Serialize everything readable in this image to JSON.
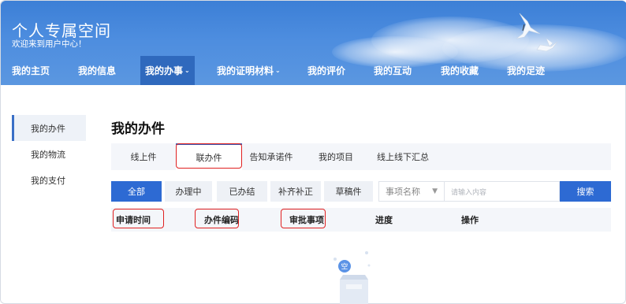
{
  "header": {
    "title": "个人专属空间",
    "subtitle": "欢迎来到用户中心！"
  },
  "nav": {
    "items": [
      {
        "label": "我的主页"
      },
      {
        "label": "我的信息"
      },
      {
        "label": "我的办事",
        "caret": "⌄"
      },
      {
        "label": "我的证明材料",
        "caret": "⌄"
      },
      {
        "label": "我的评价"
      },
      {
        "label": "我的互动"
      },
      {
        "label": "我的收藏"
      },
      {
        "label": "我的足迹"
      }
    ]
  },
  "sidebar": {
    "items": [
      {
        "label": "我的办件"
      },
      {
        "label": "我的物流"
      },
      {
        "label": "我的支付"
      }
    ]
  },
  "main": {
    "title": "我的办件",
    "tabs": [
      {
        "label": "线上件"
      },
      {
        "label": "联办件"
      },
      {
        "label": "告知承诺件"
      },
      {
        "label": "我的项目"
      },
      {
        "label": "线上线下汇总"
      }
    ],
    "filters": [
      {
        "label": "全部"
      },
      {
        "label": "办理中"
      },
      {
        "label": "已办结"
      },
      {
        "label": "补齐补正"
      },
      {
        "label": "草稿件"
      }
    ],
    "select": {
      "value": "事项名称"
    },
    "search": {
      "placeholder": "请输入内容",
      "button": "搜索"
    },
    "columns": [
      "申请时间",
      "办件编码",
      "审批事项",
      "进度",
      "操作"
    ],
    "empty_badge": "空"
  },
  "colors": {
    "brand": "#2d6ad3",
    "header": "#4a8bde",
    "highlight": "#e02020"
  }
}
